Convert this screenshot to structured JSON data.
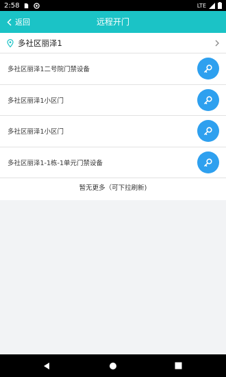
{
  "status_bar": {
    "time": "2:58",
    "network": "LTE"
  },
  "header": {
    "back_label": "返回",
    "title": "远程开门"
  },
  "location": {
    "name": "多社区丽泽1"
  },
  "doors": [
    {
      "name": "多社区丽泽1二号院门禁设备"
    },
    {
      "name": "多社区丽泽1小区门"
    },
    {
      "name": "多社区丽泽1小区门"
    },
    {
      "name": "多社区丽泽1-1栋-1单元门禁设备"
    }
  ],
  "footer_note": "暂无更多（可下拉刷新)",
  "colors": {
    "header_bg": "#1bc3c6",
    "button_blue": "#2ea0ef",
    "page_bg": "#f2f3f5"
  },
  "icons": {
    "back": "chevron-left-icon",
    "location": "location-pin-icon",
    "chevron": "chevron-right-icon",
    "open_door": "key-icon"
  }
}
